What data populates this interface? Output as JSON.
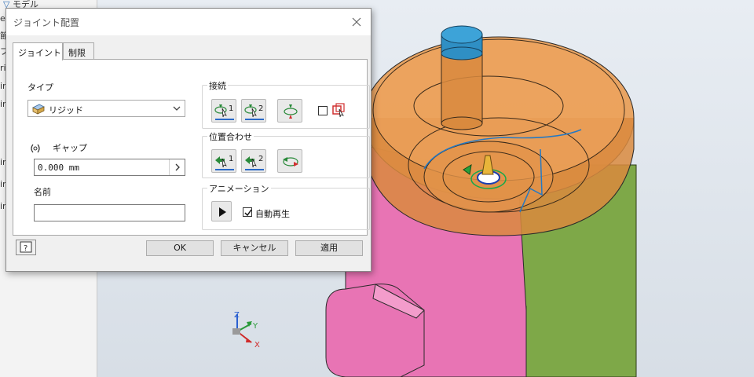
{
  "background": {
    "browser_rows": [
      "e",
      "節",
      "プ",
      "ri",
      "ir",
      "ir",
      "ir",
      "ir",
      "ir"
    ],
    "browser_top_label": "モデル"
  },
  "dialog": {
    "title": "ジョイント配置",
    "tabs": [
      {
        "label": "ジョイント",
        "active": true
      },
      {
        "label": "制限",
        "active": false
      }
    ],
    "type_section": {
      "label": "タイプ",
      "selected": "リジッド"
    },
    "gap": {
      "label": "ギャップ",
      "value": "0.000 mm"
    },
    "name": {
      "label": "名前",
      "value": ""
    },
    "connect": {
      "title": "接続",
      "button1_label": "1",
      "button2_label": "2"
    },
    "align": {
      "title": "位置合わせ",
      "button1_label": "1",
      "button2_label": "2"
    },
    "animation": {
      "title": "アニメーション",
      "autoplay_label": "自動再生",
      "autoplay_checked": true
    },
    "footer": {
      "ok": "OK",
      "cancel": "キャンセル",
      "apply": "適用"
    }
  },
  "triad": {
    "x": "X",
    "y": "Y",
    "z": "Z"
  },
  "colors": {
    "orange_part": "#e89a4f",
    "pink_part": "#e874b4",
    "green_part": "#7ea848",
    "blue_pin": "#2f8fc4"
  }
}
